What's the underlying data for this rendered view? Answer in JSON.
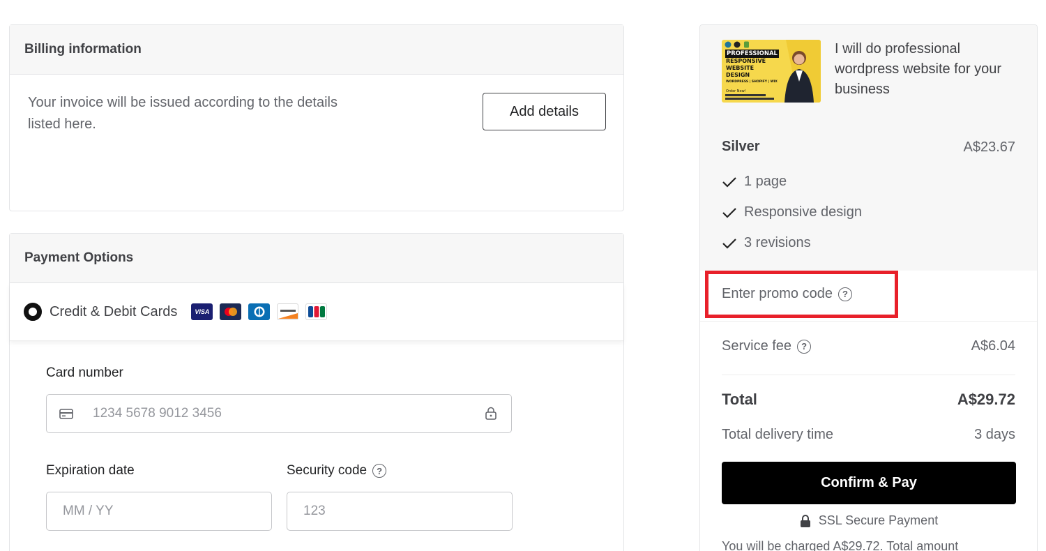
{
  "billing": {
    "title": "Billing information",
    "description": "Your invoice will be issued according to the details listed here.",
    "add_details_label": "Add details"
  },
  "payment": {
    "title": "Payment Options",
    "option_label": "Credit & Debit Cards",
    "card_logos": [
      "visa-logo",
      "mastercard-logo",
      "diners-club-logo",
      "discover-logo",
      "jcb-logo"
    ],
    "card_number_label": "Card number",
    "card_number_placeholder": "1234 5678 9012 3456",
    "expiration_label": "Expiration date",
    "expiration_placeholder": "MM / YY",
    "security_label": "Security code",
    "security_placeholder": "123"
  },
  "summary": {
    "gig_title": "I will do professional wordpress website for your business",
    "thumbnail": {
      "headline": "PROFESSIONAL",
      "lines": [
        "RESPONSIVE",
        "WEBSITE",
        "DESIGN"
      ],
      "platforms": "WORDPRESS | SHOPIFY | WIX",
      "footer": "Order Now!"
    },
    "package_name": "Silver",
    "package_price": "A$23.67",
    "features": [
      "1 page",
      "Responsive design",
      "3 revisions"
    ],
    "promo_label": "Enter promo code",
    "service_fee_label": "Service fee",
    "service_fee_value": "A$6.04",
    "total_label": "Total",
    "total_value": "A$29.72",
    "delivery_label": "Total delivery time",
    "delivery_value": "3 days",
    "confirm_label": "Confirm & Pay",
    "ssl_label": "SSL Secure Payment",
    "charged_text": "You will be charged A$29.72. Total amount"
  },
  "colors": {
    "highlight": "#e8202a",
    "primary_button": "#000000",
    "thumbnail_bg": "#f6d84c"
  }
}
